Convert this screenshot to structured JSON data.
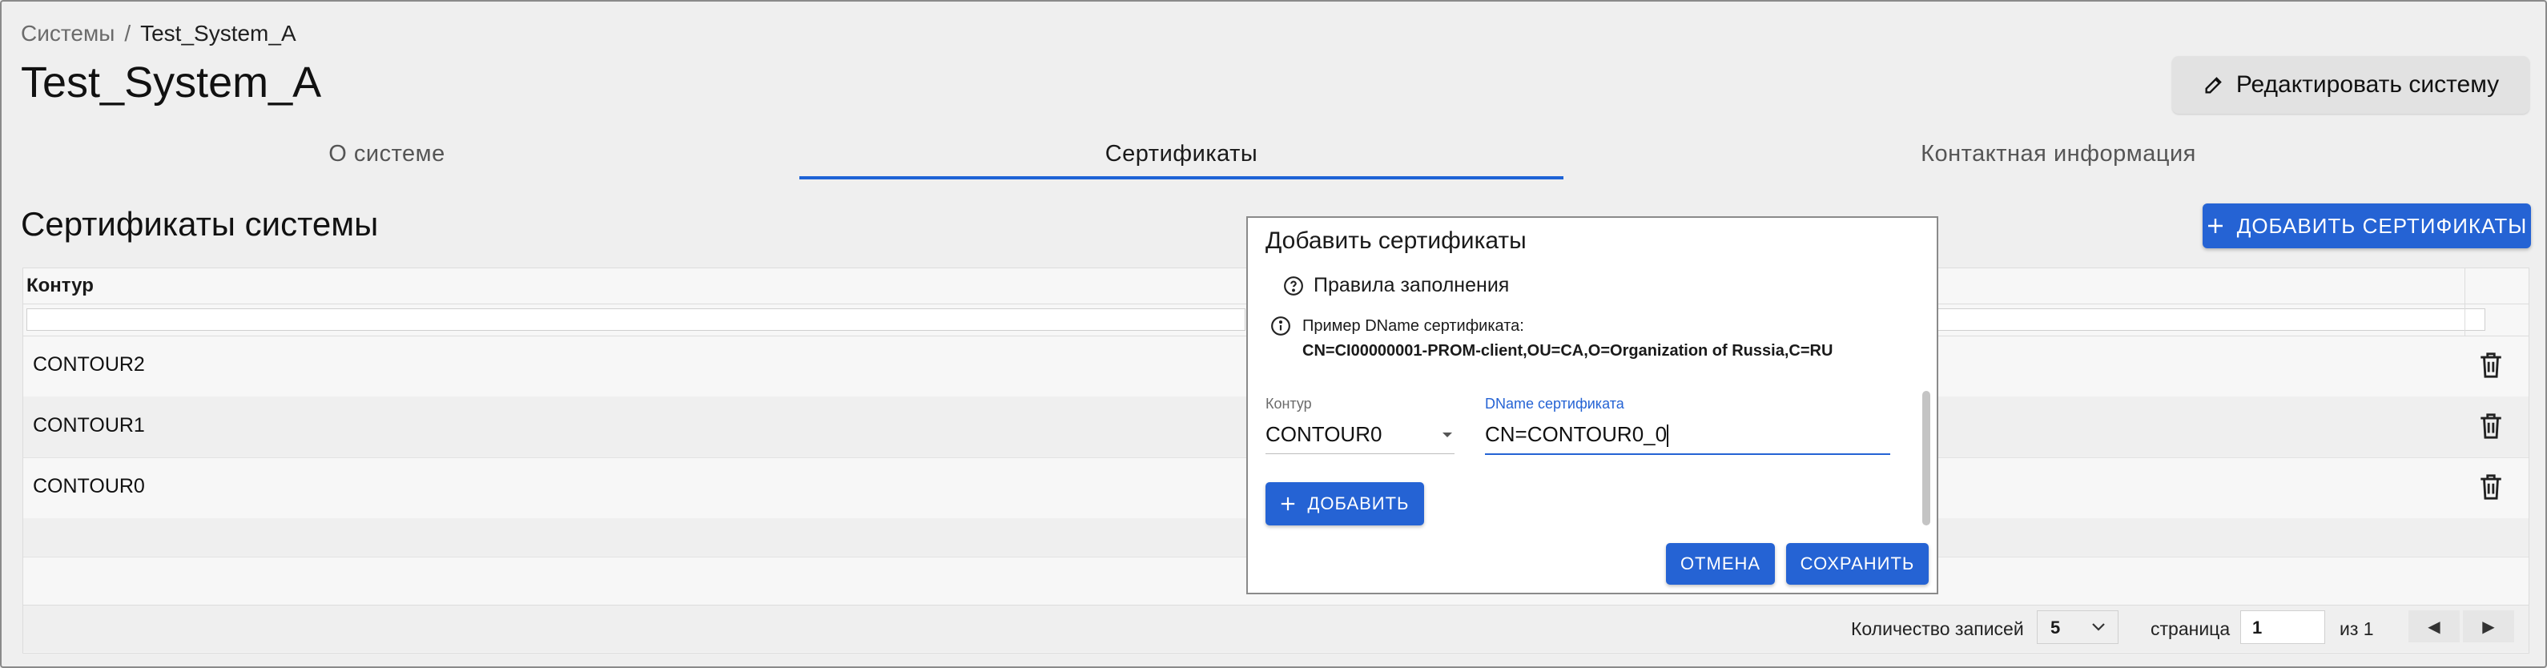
{
  "breadcrumb": {
    "parent": "Системы",
    "separator": "/",
    "current": "Test_System_A"
  },
  "page_title": "Test_System_A",
  "edit_button": {
    "label": "Редактировать систему",
    "icon": "pencil-icon"
  },
  "tabs": [
    {
      "label": "О системе",
      "active": false
    },
    {
      "label": "Сертификаты",
      "active": true
    },
    {
      "label": "Контактная информация",
      "active": false
    }
  ],
  "section_title": "Сертификаты системы",
  "add_certs_button": {
    "label": "ДОБАВИТЬ СЕРТИФИКАТЫ",
    "icon": "plus-icon"
  },
  "table": {
    "columns": [
      "Контур"
    ],
    "rows": [
      {
        "contour": "CONTOUR2"
      },
      {
        "contour": "CONTOUR1"
      },
      {
        "contour": "CONTOUR0"
      }
    ],
    "row_action_icon": "trash-icon"
  },
  "pagination": {
    "records_label": "Количество записей",
    "page_size": "5",
    "page_label": "страница",
    "page": "1",
    "of_label": "из 1",
    "prev_icon": "◀",
    "next_icon": "▶"
  },
  "dialog": {
    "title": "Добавить сертификаты",
    "rules_label": "Правила заполнения",
    "example_label": "Пример DName сертификата:",
    "example_value": "CN=CI00000001-PROM-client,OU=CA,O=Organization of Russia,C=RU",
    "contour_label": "Контур",
    "contour_value": "CONTOUR0",
    "dname_label": "DName сертификата",
    "dname_value": "CN=CONTOUR0_0",
    "add_label": "ДОБАВИТЬ",
    "cancel_label": "ОТМЕНА",
    "save_label": "СОХРАНИТЬ"
  },
  "colors": {
    "accent": "#2563d4",
    "background": "#efefef",
    "dialog": "#ffffff"
  }
}
